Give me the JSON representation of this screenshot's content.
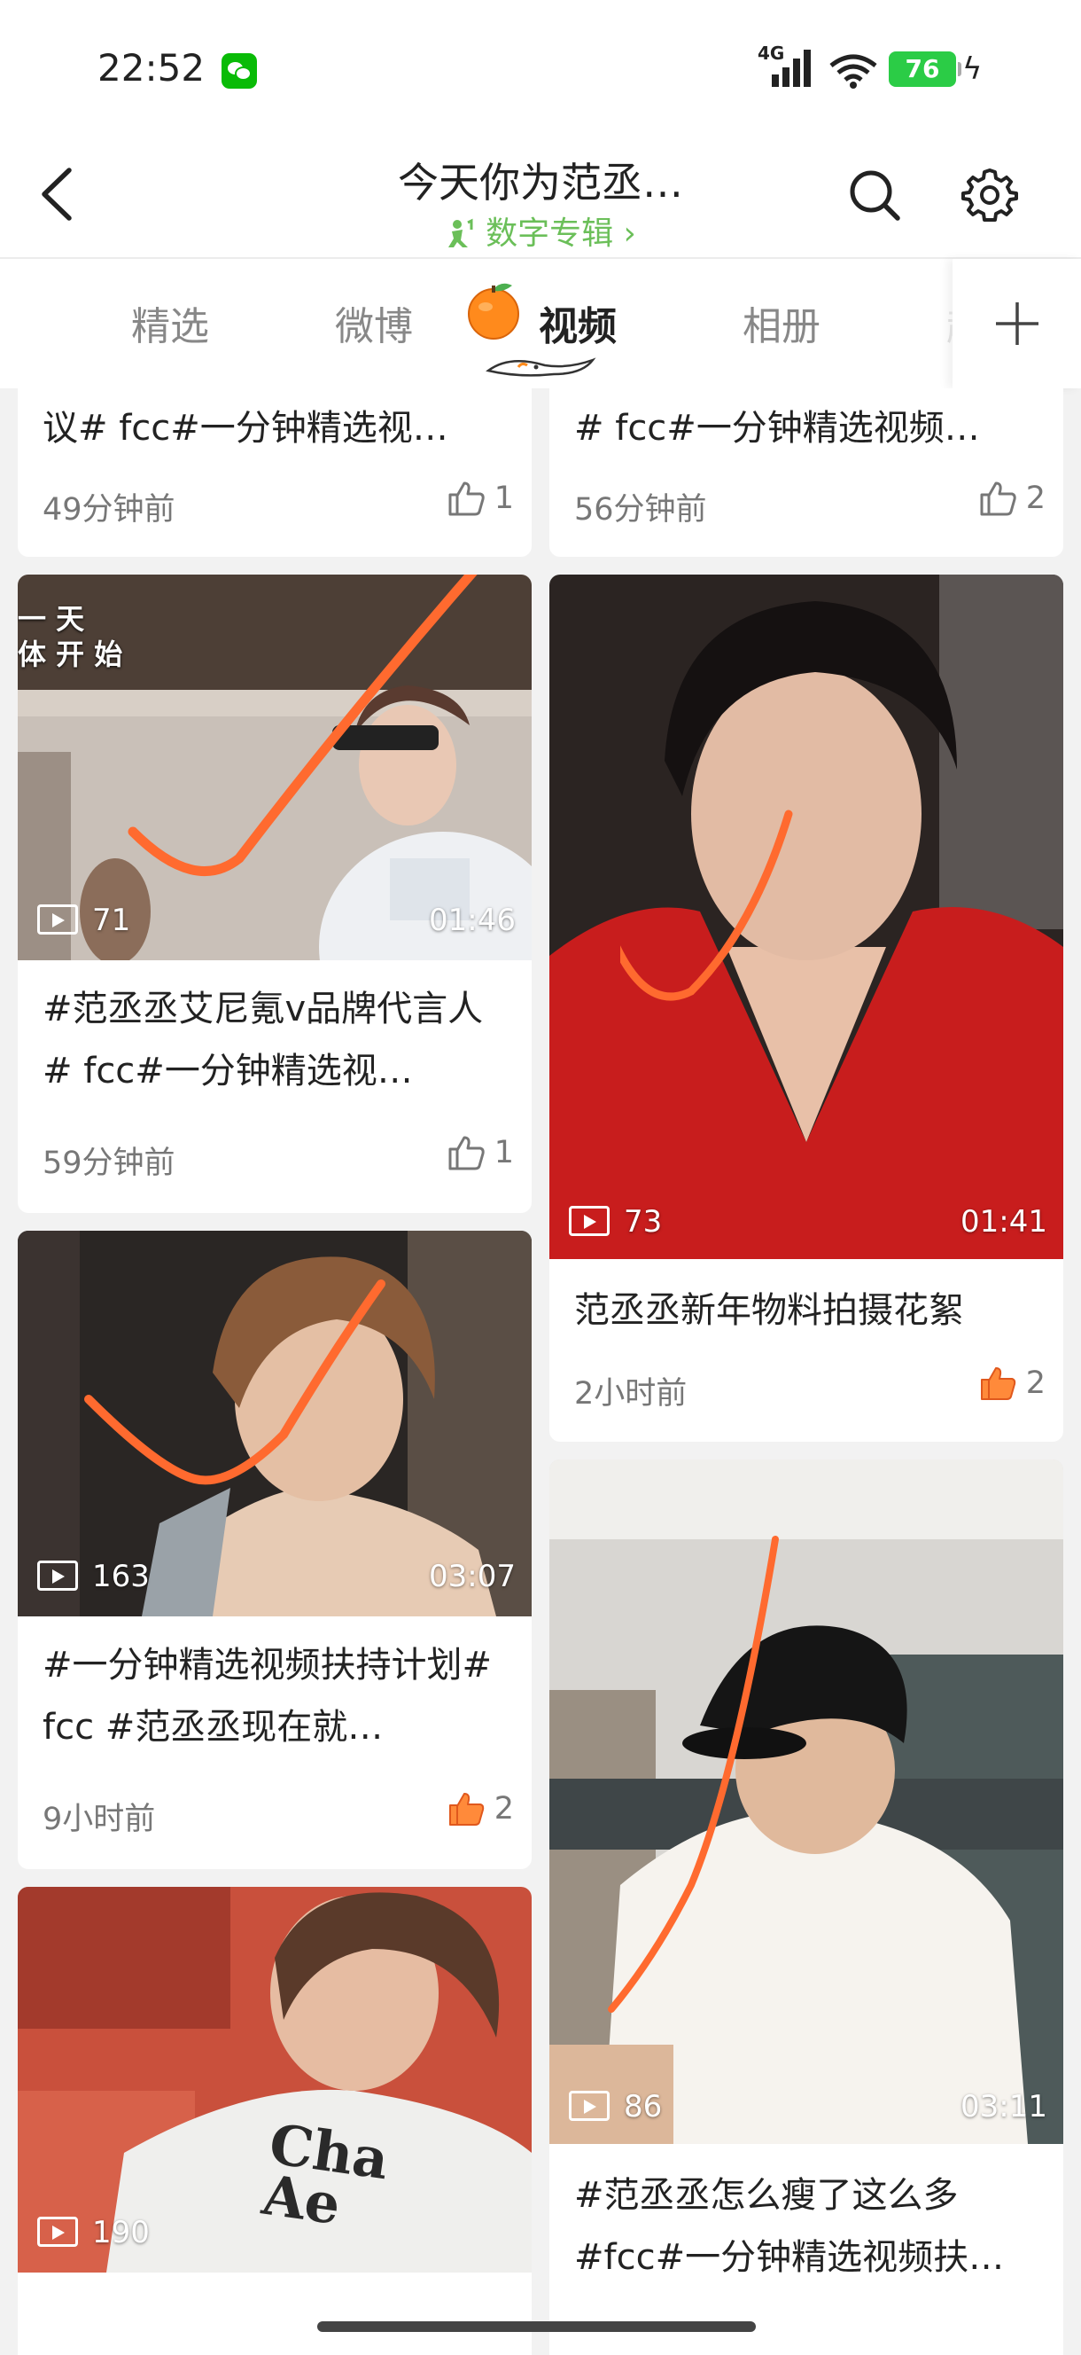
{
  "status_bar": {
    "time": "22:52",
    "network": "4G",
    "battery": "76",
    "icons": [
      "wechat-icon",
      "signal-icon",
      "wifi-icon",
      "battery-icon",
      "charging-icon"
    ]
  },
  "header": {
    "title": "今天你为范丞…",
    "subtitle": "数字专辑",
    "subtitle_chevron": "›"
  },
  "tabs": [
    {
      "label": "精选",
      "active": false
    },
    {
      "label": "微博",
      "active": false
    },
    {
      "label": "视频",
      "active": true
    },
    {
      "label": "相册",
      "active": false
    },
    {
      "label": "超",
      "active": false
    }
  ],
  "colors": {
    "accent": "#ff6a2f",
    "subtitle_green": "#6bbf59",
    "battery_green": "#2bcc46"
  },
  "cards": [
    {
      "text": "议# fcc#一分钟精选视…",
      "time": "49分钟前",
      "likes": "1",
      "liked": false
    },
    {
      "text": "# fcc#一分钟精选视频…",
      "time": "56分钟前",
      "likes": "2",
      "liked": false
    },
    {
      "views": "71",
      "duration": "01:46",
      "overlay": "一 天\n体 开 始",
      "text": "#范丞丞艾尼氪v品牌代言人# fcc#一分钟精选视…",
      "time": "59分钟前",
      "likes": "1",
      "liked": false
    },
    {
      "views": "73",
      "duration": "01:41",
      "text": "范丞丞新年物料拍摄花絮",
      "time": "2小时前",
      "likes": "2",
      "liked": true
    },
    {
      "views": "163",
      "duration": "03:07",
      "text": "#一分钟精选视频扶持计划#  fcc #范丞丞现在就…",
      "time": "9小时前",
      "likes": "2",
      "liked": true
    },
    {
      "views": "86",
      "duration": "03:11",
      "text": "#范丞丞怎么瘦了这么多#fcc#一分钟精选视频扶…"
    },
    {
      "views": "190",
      "shirt_text": "Cha\nAe"
    }
  ]
}
